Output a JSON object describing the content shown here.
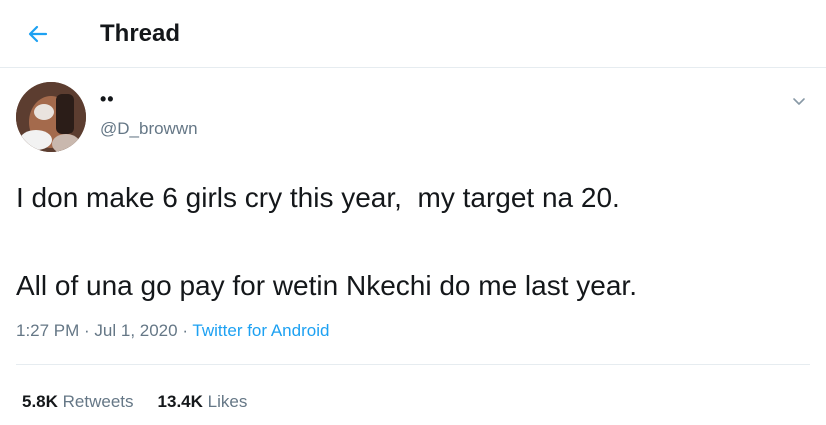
{
  "header": {
    "title": "Thread",
    "back_icon": "arrow-left-icon",
    "accent_color": "#1da1f2"
  },
  "tweet": {
    "display_name": "••",
    "handle": "@D_browwn",
    "text_lines": [
      "I don make 6 girls cry this year,  my target na 20.",
      "All of una go pay for wetin Nkechi do me last year."
    ],
    "time": "1:27 PM",
    "date": "Jul 1, 2020",
    "separator": " · ",
    "source": "Twitter for Android",
    "menu_icon": "chevron-down-icon"
  },
  "stats": {
    "retweets_count": "5.8K",
    "retweets_label": "Retweets",
    "likes_count": "13.4K",
    "likes_label": "Likes"
  }
}
